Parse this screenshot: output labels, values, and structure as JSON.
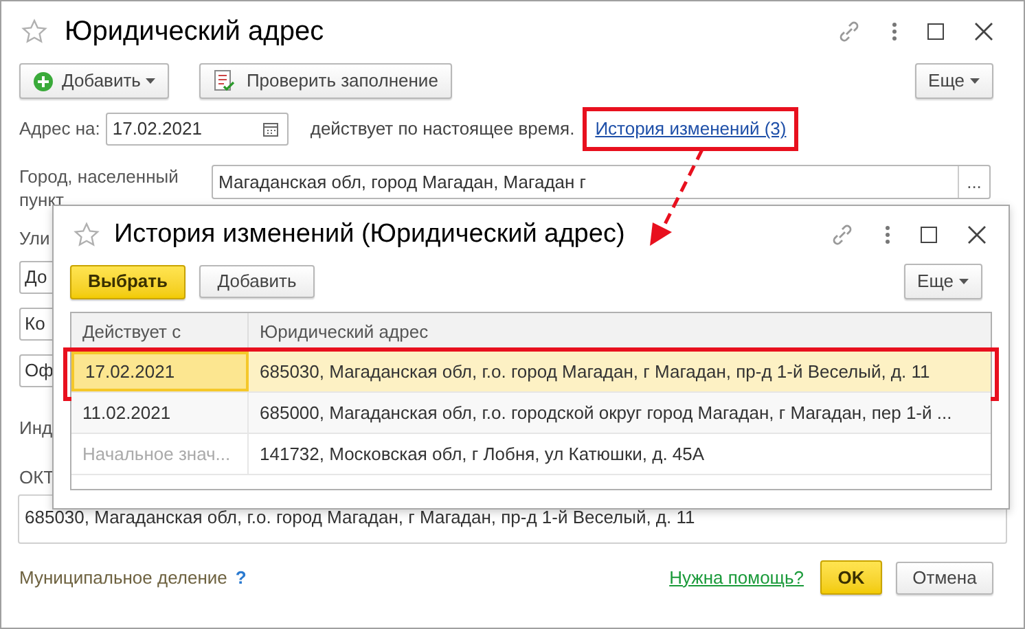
{
  "main_window": {
    "title": "Юридический адрес",
    "toolbar": [
      {
        "kind": "add",
        "label": "Добавить",
        "dropdown": true
      },
      {
        "kind": "check",
        "label": "Проверить заполнение",
        "dropdown": false
      }
    ],
    "more_button": "Еще",
    "address_date": {
      "label": "Адрес на:",
      "value": "17.02.2021"
    },
    "status_text": "действует по настоящее время.",
    "history_link": {
      "label": "История изменений (3)",
      "highlighted": true
    },
    "city": {
      "label": "Город, населенный пункт",
      "value": "Магаданская обл, город Магадан, Магадан г",
      "button": "..."
    },
    "partial_items": [
      {
        "kind": "label",
        "text": "Ули"
      },
      {
        "kind": "field",
        "text": "До"
      },
      {
        "kind": "field",
        "text": "Ко"
      },
      {
        "kind": "field",
        "text": "Оф"
      },
      {
        "kind": "label",
        "text": "Инд"
      },
      {
        "kind": "label",
        "text": "ОКТ"
      }
    ],
    "full_address": "685030, Магаданская обл, г.о. город Магадан, г Магадан, пр-д 1-й Веселый, д. 11",
    "municipal_link": "Муниципальное деление",
    "help_mark": "?",
    "help_link": "Нужна помощь?",
    "buttons": [
      {
        "label": "OK",
        "default": true
      },
      {
        "label": "Отмена",
        "default": false
      }
    ]
  },
  "dialog": {
    "title": "История изменений (Юридический адрес)",
    "buttons": [
      {
        "label": "Выбрать",
        "default": true
      },
      {
        "label": "Добавить",
        "default": false
      }
    ],
    "more_button": "Еще",
    "table": {
      "columns": [
        "Действует с",
        "Юридический адрес"
      ],
      "rows": [
        {
          "date": "17.02.2021",
          "address": "685030, Магаданская обл, г.о. город Магадан, г Магадан, пр-д 1-й Веселый, д. 11",
          "selected": true,
          "highlighted": true,
          "initial": false
        },
        {
          "date": "11.02.2021",
          "address": "685000, Магаданская обл, г.о. городской округ город Магадан, г Магадан, пер 1-й ...",
          "selected": false,
          "highlighted": false,
          "initial": false
        },
        {
          "date": "Начальное знач...",
          "address": "141732, Московская обл, г Лобня, ул Катюшки, д. 45А",
          "selected": false,
          "highlighted": false,
          "initial": true
        }
      ]
    }
  }
}
